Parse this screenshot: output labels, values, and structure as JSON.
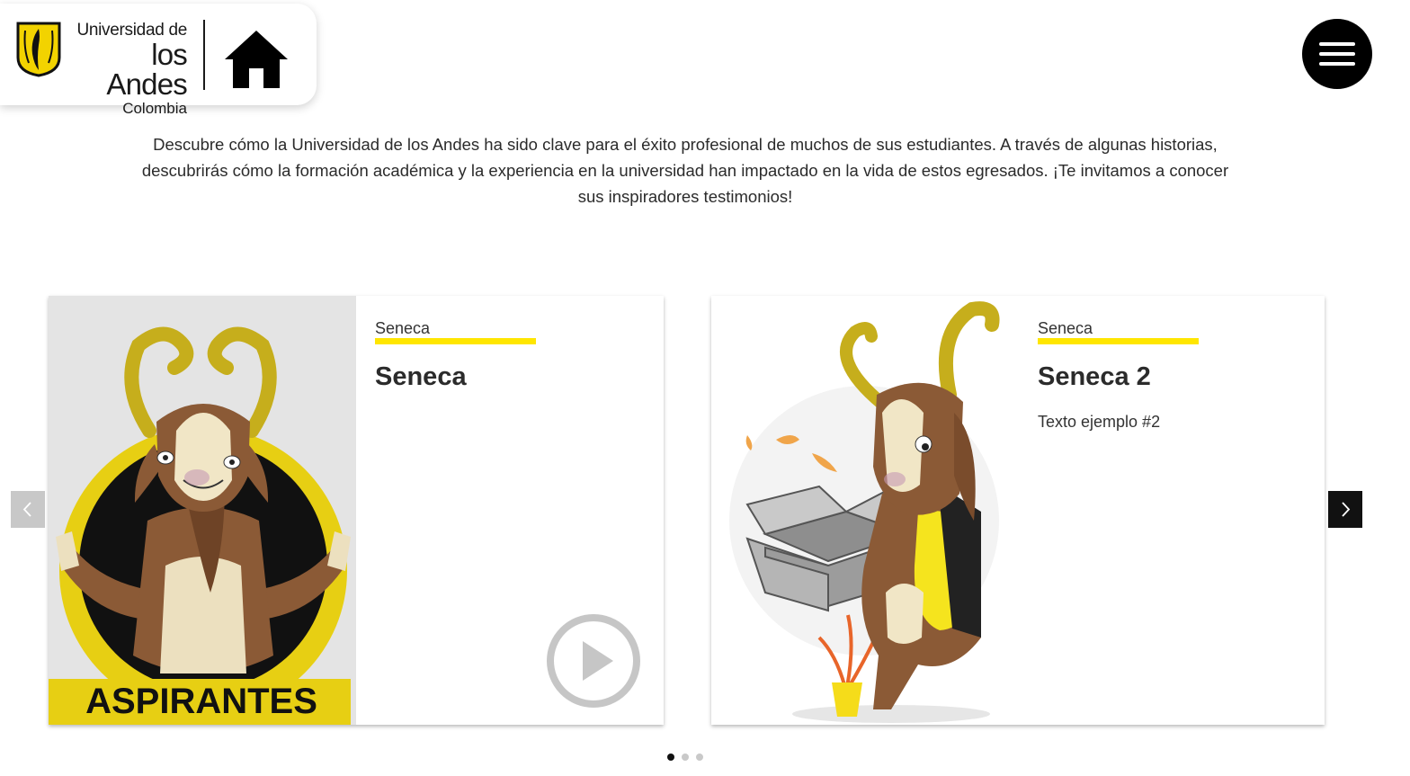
{
  "header": {
    "logo": {
      "line1": "Universidad de",
      "line2": "los Andes",
      "line3": "Colombia"
    },
    "home_icon": "home-icon",
    "menu_icon": "hamburger-menu-icon"
  },
  "intro": {
    "text": "Descubre cómo la Universidad de los Andes ha sido clave para el éxito profesional de muchos de sus estudiantes. A través de algunas historias, descubrirás cómo la formación académica y la experiencia en la universidad han impactado en la vida de estos egresados. ¡Te invitamos a conocer sus inspiradores testimonios!"
  },
  "carousel": {
    "slides": [
      {
        "category": "Seneca",
        "title": "Seneca",
        "text": "",
        "image_caption": "ASPIRANTES",
        "has_video": true
      },
      {
        "category": "Seneca",
        "title": "Seneca 2",
        "text": "Texto ejemplo #2",
        "has_video": false
      }
    ],
    "prev_icon": "chevron-left-icon",
    "next_icon": "chevron-right-icon",
    "dots_count": 3,
    "active_dot": 0
  },
  "colors": {
    "accent_yellow": "#ffe600",
    "dark": "#000000",
    "mascot_brown": "#8b5a36"
  }
}
